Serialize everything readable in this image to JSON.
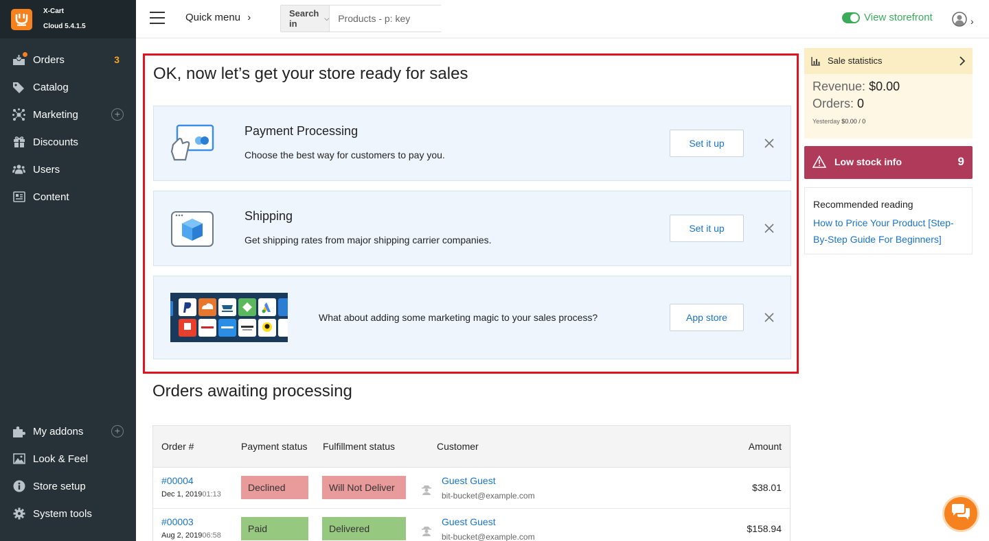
{
  "brand": {
    "name": "X-Cart",
    "version": "Cloud 5.4.1.5"
  },
  "sidebar": {
    "items": [
      {
        "label": "Orders",
        "badge": "3"
      },
      {
        "label": "Catalog"
      },
      {
        "label": "Marketing",
        "plus": "+"
      },
      {
        "label": "Discounts"
      },
      {
        "label": "Users"
      },
      {
        "label": "Content"
      }
    ],
    "bottom_items": [
      {
        "label": "My addons",
        "plus": "+"
      },
      {
        "label": "Look & Feel"
      },
      {
        "label": "Store setup"
      },
      {
        "label": "System tools"
      }
    ]
  },
  "header": {
    "quick_menu": "Quick menu",
    "quick_menu_chevron": "›",
    "search_in": "Search in",
    "search_placeholder": "Products - p: key",
    "view_storefront": "View storefront",
    "user_chevron": "›"
  },
  "onboarding": {
    "title": "OK, now let’s get your store ready for sales",
    "cards": [
      {
        "title": "Payment Processing",
        "desc": "Choose the best way for customers to pay you.",
        "button": "Set it up"
      },
      {
        "title": "Shipping",
        "desc": "Get shipping rates from major shipping carrier companies.",
        "button": "Set it up"
      },
      {
        "title": "",
        "desc": "What about adding some marketing magic to your sales process?",
        "button": "App store"
      }
    ]
  },
  "orders": {
    "title": "Orders awaiting processing",
    "columns": [
      "Order #",
      "Payment status",
      "Fulfillment status",
      "Customer",
      "Amount"
    ],
    "rows": [
      {
        "number": "#00004",
        "date": "Dec 1, 2019",
        "time": "01:13",
        "payment": "Declined",
        "payment_color": "#e99a9a",
        "fulfillment": "Will Not Deliver",
        "fulfillment_color": "#e99a9a",
        "customer": "Guest Guest",
        "email": "bit-bucket@example.com",
        "amount": "$38.01"
      },
      {
        "number": "#00003",
        "date": "Aug 2, 2019",
        "time": "06:58",
        "payment": "Paid",
        "payment_color": "#96c97f",
        "fulfillment": "Delivered",
        "fulfillment_color": "#96c97f",
        "customer": "Guest Guest",
        "email": "bit-bucket@example.com",
        "amount": "$158.94"
      }
    ]
  },
  "stats": {
    "title": "Sale statistics",
    "revenue_label": "Revenue:",
    "revenue_value": "$0.00",
    "orders_label": "Orders:",
    "orders_value": "0",
    "yesterday_label": "Yesterday",
    "yesterday_value": "$0.00 / 0"
  },
  "low_stock": {
    "label": "Low stock info",
    "count": "9"
  },
  "reading": {
    "title": "Recommended reading",
    "link": "How to Price Your Product [Step-By-Step Guide For Beginners]"
  },
  "colors": {
    "sidebar": "#263238",
    "accent": "#f5821f",
    "link": "#1a73c7",
    "storefront": "#3bab5b",
    "low_stock": "#b03a5a",
    "highlight_border": "#e0141e"
  }
}
